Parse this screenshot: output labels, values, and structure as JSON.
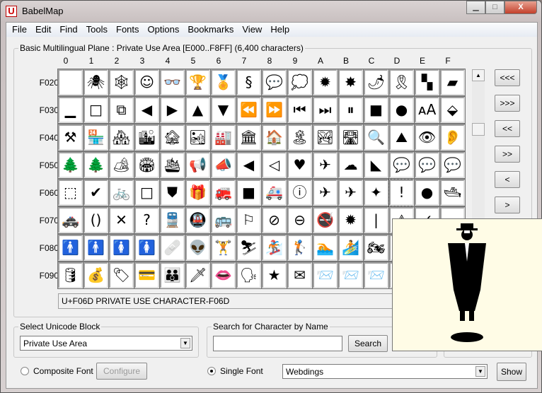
{
  "window": {
    "title": "BabelMap",
    "icon": "U"
  },
  "menu": [
    "File",
    "Edit",
    "Find",
    "Tools",
    "Fonts",
    "Options",
    "Bookmarks",
    "View",
    "Help"
  ],
  "grid": {
    "label": "Basic Multilingual Plane : Private Use Area [E000..F8FF] (6,400 characters)",
    "columns": [
      "0",
      "1",
      "2",
      "3",
      "4",
      "5",
      "6",
      "7",
      "8",
      "9",
      "A",
      "B",
      "C",
      "D",
      "E",
      "F"
    ],
    "rows": [
      "F020",
      "F030",
      "F040",
      "F050",
      "F060",
      "F070",
      "F080",
      "F090"
    ],
    "glyphs": [
      " ",
      "🕷",
      "🕸",
      "☺",
      "👓",
      "🏆",
      "🏅",
      "§",
      "💬",
      "💭",
      "✹",
      "✸",
      "🌶",
      "🎗",
      "▚",
      "▰",
      "▁",
      "□",
      "⧉",
      "◀",
      "▶",
      "▲",
      "▼",
      "⏪",
      "⏩",
      "⏮",
      "⏭",
      "⏸",
      "■",
      "●",
      "ᴀA",
      "⬙",
      "⚒",
      "🏪",
      "🏘",
      "🏙",
      "🏚",
      "🏜",
      "🏭",
      "🏛",
      "🏠",
      "🏝",
      "🏞",
      "🛣",
      "🔍",
      "⛰",
      "👁",
      "👂",
      "🌲",
      "🌲",
      "🏕",
      "🏟",
      "🛳",
      "📢",
      "📣",
      "◀",
      "◁",
      "♥",
      "✈",
      "☁",
      "◣",
      "💬",
      "💬",
      "💬",
      "⬚",
      "✔",
      "🚲",
      "□",
      "⛊",
      "🎁",
      "🚒",
      "■",
      "🚑",
      "ⓘ",
      "✈",
      "✈",
      "✦",
      "!",
      "●",
      "🛥",
      "🚓",
      "()",
      "✕",
      "?",
      "🚆",
      "🚇",
      "🚌",
      "⚐",
      "⊘",
      "⊖",
      "🚭",
      "✹",
      "|",
      "⚠",
      "✓",
      "—",
      "🚹",
      "🚹",
      "🚺",
      "🚺",
      "🩹",
      "👽",
      "🏋",
      "⛷",
      "🏂",
      "🏌",
      "🏊",
      "🏄",
      "🏍",
      "🚴",
      "—",
      "—",
      "🛢",
      "💰",
      "🏷",
      "💳",
      "👪",
      "🗡",
      "👄",
      "🗣",
      "★",
      "✉",
      "📨",
      "📨",
      "📨",
      "📨",
      "—",
      "—"
    ],
    "selected": "F06D",
    "status": "U+F06D PRIVATE USE CHARACTER-F06D"
  },
  "nav": [
    "<<<",
    ">>>",
    "<<",
    ">>",
    "<",
    ">"
  ],
  "block": {
    "label": "Select Unicode Block",
    "value": "Private Use Area"
  },
  "search": {
    "label": "Search for Character by Name",
    "value": "",
    "button": "Search"
  },
  "font": {
    "composite_label": "Composite Font",
    "configure": "Configure",
    "single_label": "Single Font",
    "value": "Webdings",
    "show": "Show",
    "mode": "single"
  }
}
